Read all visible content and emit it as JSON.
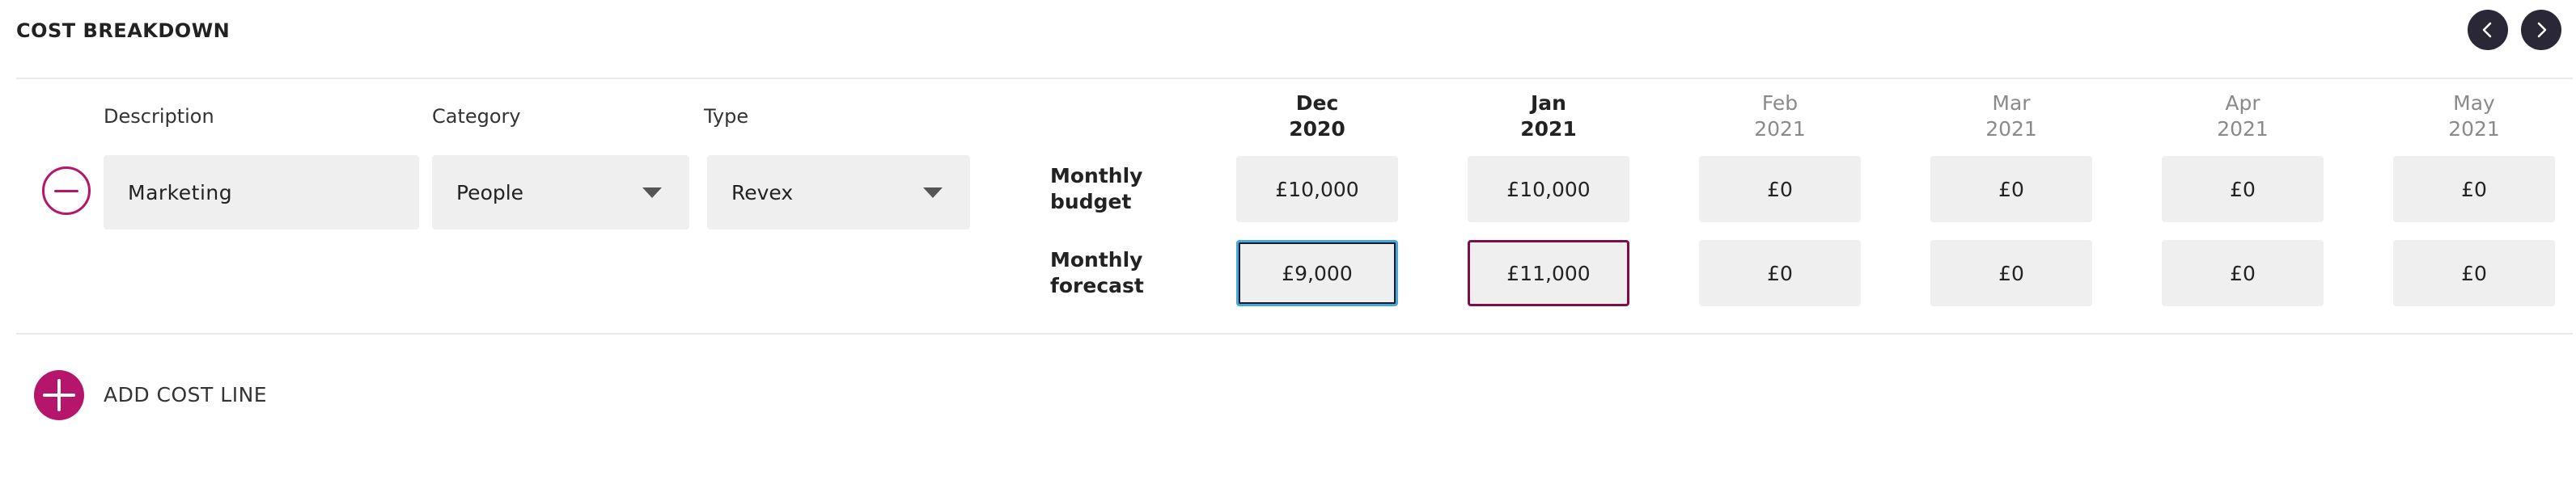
{
  "header": {
    "title": "COST BREAKDOWN",
    "prev_icon": "chevron-left-icon",
    "next_icon": "chevron-right-icon"
  },
  "columns": {
    "description": "Description",
    "category": "Category",
    "type": "Type"
  },
  "cost_line": {
    "description": "Marketing",
    "category": "People",
    "type": "Revex",
    "remove_icon": "minus-circle-icon"
  },
  "row_labels": {
    "budget": [
      "Monthly",
      "budget"
    ],
    "forecast": [
      "Monthly",
      "forecast"
    ]
  },
  "months": [
    {
      "month": "Dec",
      "year": "2020",
      "active": true,
      "budget": "£10,000",
      "forecast": "£9,000"
    },
    {
      "month": "Jan",
      "year": "2021",
      "active": true,
      "budget": "£10,000",
      "forecast": "£11,000"
    },
    {
      "month": "Feb",
      "year": "2021",
      "active": false,
      "budget": "£0",
      "forecast": "£0"
    },
    {
      "month": "Mar",
      "year": "2021",
      "active": false,
      "budget": "£0",
      "forecast": "£0"
    },
    {
      "month": "Apr",
      "year": "2021",
      "active": false,
      "budget": "£0",
      "forecast": "£0"
    },
    {
      "month": "May",
      "year": "2021",
      "active": false,
      "budget": "£0",
      "forecast": "£0"
    }
  ],
  "footer": {
    "add_label": "ADD COST LINE",
    "add_icon": "plus-circle-icon"
  },
  "colors": {
    "accent": "#b5156b",
    "nav_button": "#2a2836",
    "field_bg": "#efefef",
    "focus_blue": "#46a7d9",
    "focus_magenta": "#7a0f4a",
    "muted_text": "#8a8a8a"
  }
}
